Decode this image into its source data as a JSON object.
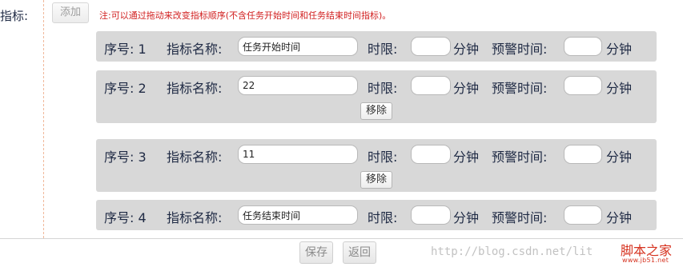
{
  "form": {
    "field_label": "指标:",
    "add_button": "添加",
    "note": "注:可以通过拖动来改变指标顺序(不含任务开始时间和任务结束时间指标)。"
  },
  "row_labels": {
    "seq_prefix": "序号:",
    "name_label": "指标名称:",
    "limit_label": "时限:",
    "warn_label": "预警时间:",
    "unit": "分钟",
    "remove_button": "移除"
  },
  "rows": [
    {
      "seq": "1",
      "name": "任务开始时间",
      "limit": "",
      "warn": "",
      "removable": false
    },
    {
      "seq": "2",
      "name": "22",
      "limit": "",
      "warn": "",
      "removable": true
    },
    {
      "seq": "3",
      "name": "11",
      "limit": "",
      "warn": "",
      "removable": true
    },
    {
      "seq": "4",
      "name": "任务结束时间",
      "limit": "",
      "warn": "",
      "removable": false
    }
  ],
  "footer": {
    "save_button": "保存",
    "back_button": "返回"
  },
  "watermark": {
    "url_text": "http://blog.csdn.net/lit",
    "logo_text": "脚本之家",
    "logo_sub": "www.jb51.net"
  }
}
